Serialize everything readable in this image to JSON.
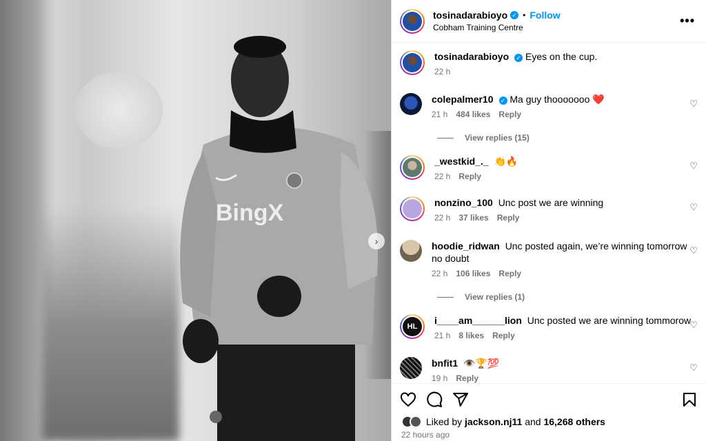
{
  "post": {
    "author": "tosinadarabioyo",
    "follow_label": "Follow",
    "location": "Cobham Training Centre",
    "more_label": "•••",
    "caption": "Eyes on the cup.",
    "caption_time": "22 h",
    "photo_text": "BingX"
  },
  "comments": [
    {
      "user": "colepalmer10",
      "verified": true,
      "text": "Ma guy thooooooo ❤️",
      "time": "21 h",
      "likes": "484 likes",
      "reply": "Reply",
      "view_replies": "View replies (15)"
    },
    {
      "user": "_westkid_._",
      "verified": false,
      "text": "👏🔥",
      "time": "22 h",
      "likes": "",
      "reply": "Reply"
    },
    {
      "user": "nonzino_100",
      "verified": false,
      "text": "Unc post we are winning",
      "time": "22 h",
      "likes": "37 likes",
      "reply": "Reply"
    },
    {
      "user": "hoodie_ridwan",
      "verified": false,
      "text": "Unc posted again, we’re winning tomorrow no doubt",
      "time": "22 h",
      "likes": "106 likes",
      "reply": "Reply",
      "view_replies": "View replies (1)"
    },
    {
      "user": "i____am______lion",
      "verified": false,
      "text": "Unc posted we are winning tommorow",
      "time": "21 h",
      "likes": "8 likes",
      "reply": "Reply",
      "avatar_text": "HL"
    },
    {
      "user": "bnfit1",
      "verified": false,
      "text": "👁️🏆💯",
      "time": "19 h",
      "likes": "",
      "reply": "Reply"
    }
  ],
  "footer": {
    "liked_by_prefix": "Liked by",
    "liked_by_user": "jackson.nj11",
    "liked_by_and": "and",
    "liked_by_others": "16,268 others",
    "posted_ago": "22 hours ago"
  },
  "colors": {
    "accent": "#0095f6",
    "muted": "#737373",
    "border": "#dbdbdb"
  },
  "icons": [
    "heart-icon",
    "comment-icon",
    "share-icon",
    "save-icon",
    "verified-icon",
    "more-icon",
    "chevron-right-icon"
  ]
}
